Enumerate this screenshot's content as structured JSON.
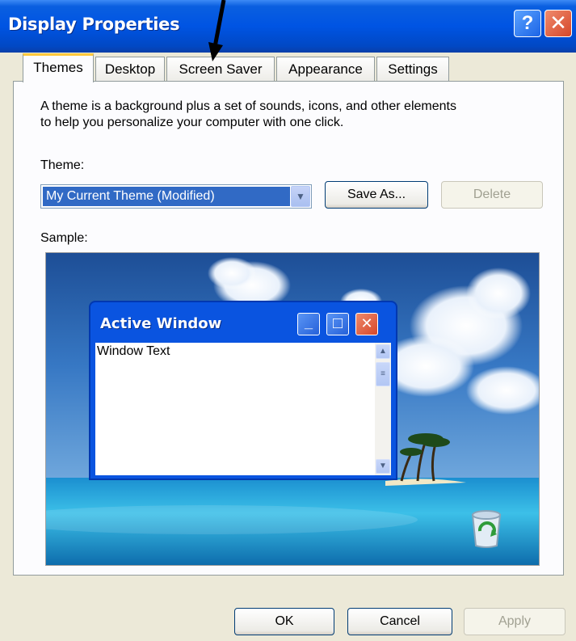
{
  "window": {
    "title": "Display Properties",
    "help_glyph": "?",
    "close_glyph": "✕"
  },
  "tabs": [
    {
      "label": "Themes",
      "active": true
    },
    {
      "label": "Desktop"
    },
    {
      "label": "Screen Saver"
    },
    {
      "label": "Appearance"
    },
    {
      "label": "Settings"
    }
  ],
  "themes_page": {
    "description_line1": "A theme is a background plus a set of sounds, icons, and other elements",
    "description_line2": "to help you personalize your computer with one click.",
    "theme_label": "Theme:",
    "theme_value": "My Current Theme (Modified)",
    "save_as_label": "Save As...",
    "delete_label": "Delete",
    "sample_label": "Sample:"
  },
  "sample_window": {
    "title": "Active Window",
    "text": "Window Text",
    "minimize_glyph": "_",
    "maximize_glyph": "□",
    "close_glyph": "✕"
  },
  "footer": {
    "ok_label": "OK",
    "cancel_label": "Cancel",
    "apply_label": "Apply"
  },
  "icons": {
    "recycle_bin": "recycle-bin-icon",
    "annotation_arrow": "arrow-icon"
  },
  "colors": {
    "title_blue": "#0054e3",
    "dialog_bg": "#ece9d8",
    "selection_blue": "#316ac5",
    "close_red": "#d5472a",
    "active_tab_accent": "#ffc83c"
  }
}
